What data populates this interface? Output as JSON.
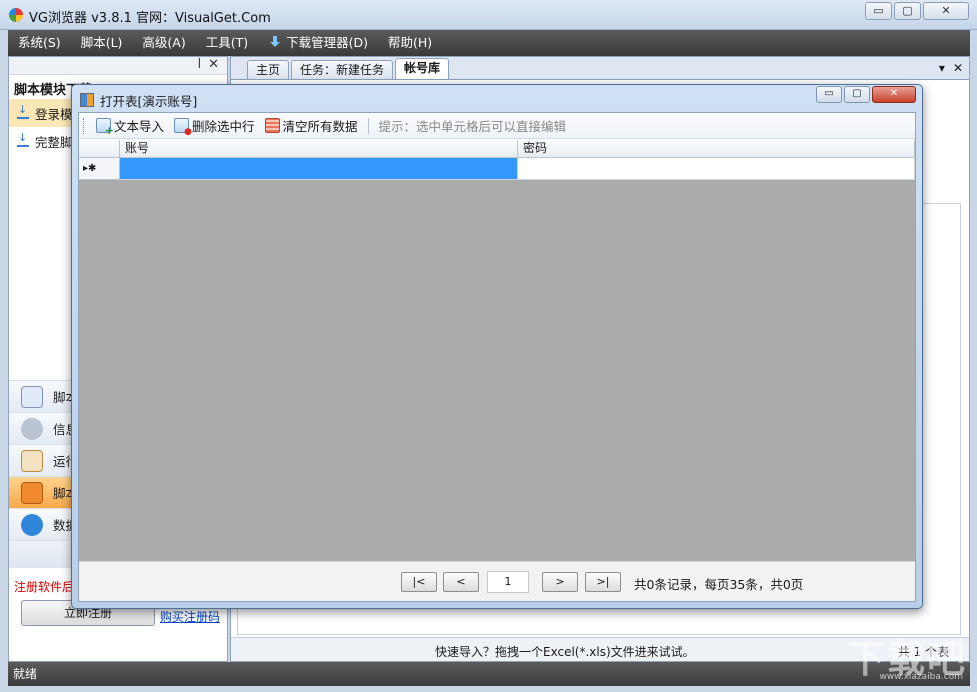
{
  "window": {
    "title": "VG浏览器 v3.8.1 官网：VisualGet.Com",
    "min": "▭",
    "max": "▢",
    "close": "✕"
  },
  "menu": [
    {
      "label": "系统(S)"
    },
    {
      "label": "脚本(L)"
    },
    {
      "label": "高级(A)"
    },
    {
      "label": "工具(T)"
    },
    {
      "label": "下载管理器(D)",
      "icon": "download-icon"
    },
    {
      "label": "帮助(H)"
    }
  ],
  "left_panel": {
    "pin": "ꟾ",
    "close": "✕",
    "title": "脚本模块下载",
    "items": [
      {
        "label": "登录模"
      },
      {
        "label": "完整脚"
      }
    ],
    "nav": [
      {
        "label": "脚本",
        "icon": "script-edit-icon",
        "color": "#dfe9f7"
      },
      {
        "label": "信息",
        "icon": "database-icon",
        "color": "#b9c4d2"
      },
      {
        "label": "运行",
        "icon": "task-list-icon",
        "color": "#f3e2c2"
      },
      {
        "label": "脚本",
        "icon": "store-icon",
        "color": "#f08a2e"
      },
      {
        "label": "数据",
        "icon": "download-circle-icon",
        "color": "#2f86d8"
      }
    ],
    "register_text": "注册软件后",
    "register_button": "立即注册",
    "buy_link": "购买注册码"
  },
  "tabs": [
    {
      "label": "主页"
    },
    {
      "label": "任务：新建任务"
    },
    {
      "label": "帐号库",
      "active": true
    }
  ],
  "tab_tools": {
    "dropdown": "▾",
    "close": "✕"
  },
  "status_area": {
    "quick_tip": "快速导入？拖拽一个Excel(*.xls)文件进来试试。",
    "total": "共 1 个表"
  },
  "statusbar": {
    "text": "就绪"
  },
  "watermark": {
    "text": "下载吧",
    "sub": "www.xiazaiba.com"
  },
  "dialog": {
    "title": "打开表[演示账号]",
    "min": "▭",
    "max": "▢",
    "close": "✕",
    "toolbar": {
      "import": "文本导入",
      "delete": "删除选中行",
      "clear": "清空所有数据",
      "hint": "提示：选中单元格后可以直接编辑"
    },
    "columns": [
      "账号",
      "密码"
    ],
    "row_marker": "▸✱",
    "pager": {
      "first": "|<",
      "prev": "<",
      "page": "1",
      "next": ">",
      "last": ">|",
      "info": "共0条记录，每页35条，共0页"
    }
  }
}
